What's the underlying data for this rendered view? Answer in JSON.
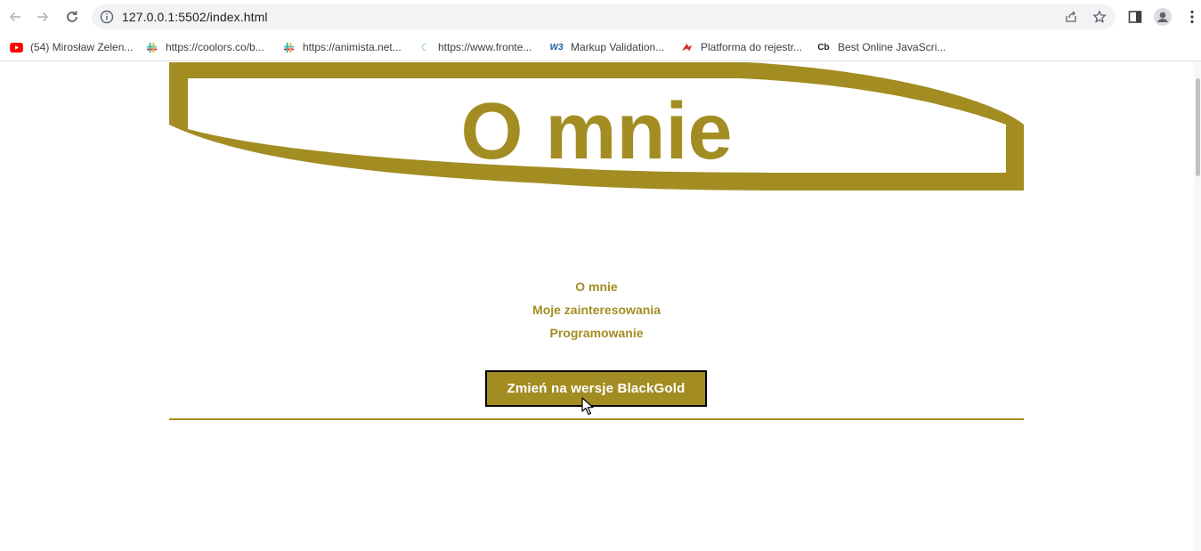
{
  "browser": {
    "url": "127.0.0.1:5502/index.html",
    "bookmarks": [
      {
        "label": "(54) Mirosław Zelen...",
        "icon": "youtube-icon"
      },
      {
        "label": "https://coolors.co/b...",
        "icon": "slack-icon"
      },
      {
        "label": "https://animista.net...",
        "icon": "slack-icon"
      },
      {
        "label": "https://www.fronte...",
        "icon": "frontend-icon"
      },
      {
        "label": "Markup Validation...",
        "icon": "w3c-icon"
      },
      {
        "label": "Platforma do rejestr...",
        "icon": "platform-icon"
      },
      {
        "label": "Best Online JavaScri...",
        "icon": "codebeautify-icon"
      }
    ]
  },
  "page": {
    "title": "O mnie",
    "menu": [
      "O mnie",
      "Moje zainteresowania",
      "Programowanie"
    ],
    "theme_button": "Zmień na wersje BlackGold"
  },
  "colors": {
    "accent": "#a38d23",
    "button_border": "#000000",
    "button_text": "#ffffff"
  }
}
